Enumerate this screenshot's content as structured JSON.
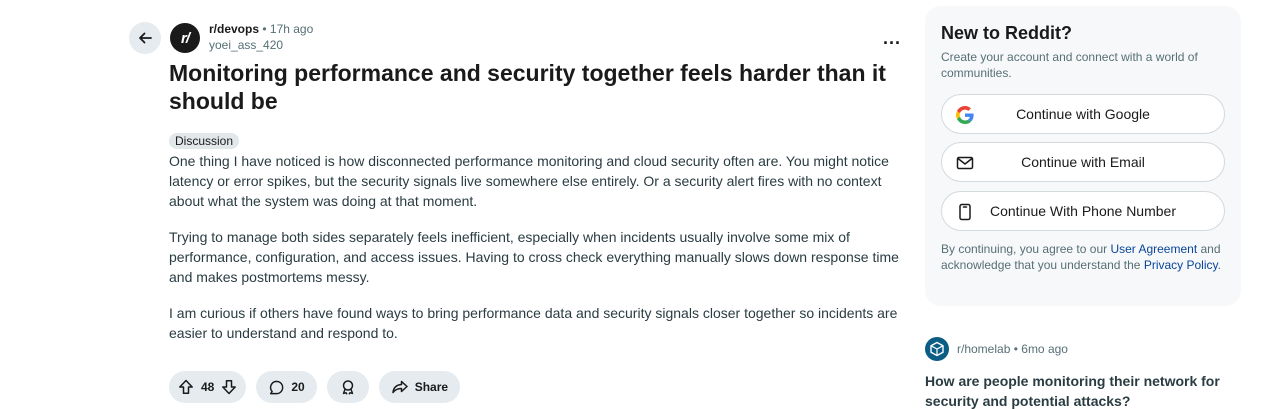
{
  "post": {
    "subreddit": "r/devops",
    "separator": "•",
    "time": "17h ago",
    "author": "yoei_ass_420",
    "title": "Monitoring performance and security together feels harder than it should be",
    "flair": "Discussion",
    "paragraphs": [
      "One thing I have noticed is how disconnected performance monitoring and cloud security often are. You might notice latency or error spikes, but the security signals live somewhere else entirely. Or a security alert fires with no context about what the system was doing at that moment.",
      "Trying to manage both sides separately feels inefficient, especially when incidents usually involve some mix of performance, configuration, and access issues. Having to cross check everything manually slows down response time and makes postmortems messy.",
      "I am curious if others have found ways to bring performance data and security signals closer together so incidents are easier to understand and respond to."
    ],
    "upvotes": "48",
    "comments": "20",
    "share_label": "Share",
    "more_label": "..."
  },
  "sidebar": {
    "title": "New to Reddit?",
    "subtitle": "Create your account and connect with a world of communities.",
    "buttons": {
      "google": "Continue with Google",
      "email": "Continue with Email",
      "phone": "Continue With Phone Number"
    },
    "terms_prefix": "By continuing, you agree to our ",
    "terms_link": "User Agreement",
    "terms_middle": " and acknowledge that you understand the ",
    "privacy_link": "Privacy Policy",
    "terms_suffix": "."
  },
  "related": {
    "subreddit": "r/homelab",
    "separator": "•",
    "time": "6mo ago",
    "title": "How are people monitoring their network for security and potential attacks?"
  },
  "icons": {
    "back": "arrow-left-icon",
    "more": "ellipsis-icon",
    "upvote": "arrow-up-icon",
    "downvote": "arrow-down-icon",
    "comment": "speech-bubble-icon",
    "award": "award-icon",
    "share": "share-arrow-icon",
    "google": "google-logo-icon",
    "email": "envelope-icon",
    "phone": "phone-icon"
  },
  "colors": {
    "accent_link": "#0a449b",
    "pill_bg": "#e5ebee",
    "card_bg": "#f6f8f9"
  }
}
